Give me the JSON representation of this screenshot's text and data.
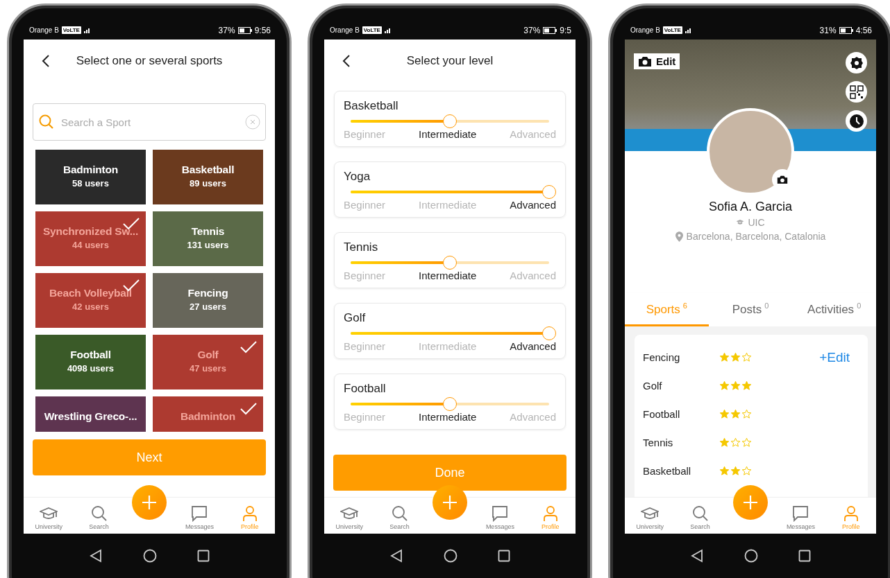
{
  "phones": [
    {
      "kind": "sports",
      "status": {
        "carrier": "Orange B",
        "network": "VoLTE",
        "battery": "37%",
        "time": "9:56"
      },
      "title": "Select one or several sports",
      "search": {
        "placeholder": "Search a Sport"
      },
      "tiles": [
        {
          "name": "Badminton",
          "users": "58 users",
          "selected": false
        },
        {
          "name": "Basketball",
          "users": "89 users",
          "selected": false
        },
        {
          "name": "Synchronized Sw...",
          "users": "44 users",
          "selected": true
        },
        {
          "name": "Tennis",
          "users": "131 users",
          "selected": false
        },
        {
          "name": "Beach Volleyball",
          "users": "42 users",
          "selected": true
        },
        {
          "name": "Fencing",
          "users": "27 users",
          "selected": false
        },
        {
          "name": "Football",
          "users": "4098 users",
          "selected": false
        },
        {
          "name": "Golf",
          "users": "47 users",
          "selected": true
        },
        {
          "name": "Wrestling Greco-...",
          "selected": false
        },
        {
          "name": "Badminton",
          "selected": true
        }
      ],
      "button": "Next",
      "nav": [
        {
          "label": "University",
          "selected": false
        },
        {
          "label": "Search",
          "selected": false
        },
        {
          "label": "Messages",
          "selected": false
        },
        {
          "label": "Profile",
          "selected": true
        }
      ]
    },
    {
      "kind": "levels",
      "status": {
        "carrier": "Orange B",
        "network": "VoLTE",
        "battery": "37%",
        "time": "9:5"
      },
      "title": "Select your level",
      "levels": [
        {
          "name": "Basketball",
          "level": 0.5,
          "labels": [
            {
              "text": "Beginner",
              "selected": false
            },
            {
              "text": "Intermediate",
              "selected": true
            },
            {
              "text": "Advanced",
              "selected": false
            }
          ]
        },
        {
          "name": "Yoga",
          "level": 1,
          "labels": [
            {
              "text": "Beginner",
              "selected": false
            },
            {
              "text": "Intermediate",
              "selected": false
            },
            {
              "text": "Advanced",
              "selected": true
            }
          ]
        },
        {
          "name": "Tennis",
          "level": 0.5,
          "labels": [
            {
              "text": "Beginner",
              "selected": false
            },
            {
              "text": "Intermediate",
              "selected": true
            },
            {
              "text": "Advanced",
              "selected": false
            }
          ]
        },
        {
          "name": "Golf",
          "level": 1,
          "labels": [
            {
              "text": "Beginner",
              "selected": false
            },
            {
              "text": "Intermediate",
              "selected": false
            },
            {
              "text": "Advanced",
              "selected": true
            }
          ]
        },
        {
          "name": "Football",
          "level": 0.5,
          "labels": [
            {
              "text": "Beginner",
              "selected": false
            },
            {
              "text": "Intermediate",
              "selected": true
            },
            {
              "text": "Advanced",
              "selected": false
            }
          ]
        }
      ],
      "button": "Done",
      "nav": [
        {
          "label": "University",
          "selected": false
        },
        {
          "label": "Search",
          "selected": false
        },
        {
          "label": "Messages",
          "selected": false
        },
        {
          "label": "Profile",
          "selected": true
        }
      ]
    },
    {
      "kind": "profile",
      "status": {
        "carrier": "Orange B",
        "network": "VoLTE",
        "battery": "31%",
        "time": "4:56"
      },
      "edit_cover": "Edit",
      "name": "Sofia A. Garcia",
      "school": "UIC",
      "location": "Barcelona, Barcelona, Catalonia",
      "tabs": [
        {
          "label": "Sports",
          "count": "6",
          "selected": true
        },
        {
          "label": "Posts",
          "count": "0",
          "selected": false
        },
        {
          "label": "Activities",
          "count": "0",
          "selected": false
        }
      ],
      "sports": [
        {
          "name": "Fencing",
          "stars": 2
        },
        {
          "name": "Golf",
          "stars": 3
        },
        {
          "name": "Football",
          "stars": 2
        },
        {
          "name": "Tennis",
          "stars": 1
        },
        {
          "name": "Basketball",
          "stars": 2
        }
      ],
      "edit_link": "+Edit",
      "nav": [
        {
          "label": "University",
          "selected": false
        },
        {
          "label": "Search",
          "selected": false
        },
        {
          "label": "Messages",
          "selected": false
        },
        {
          "label": "Profile",
          "selected": true
        }
      ]
    }
  ]
}
